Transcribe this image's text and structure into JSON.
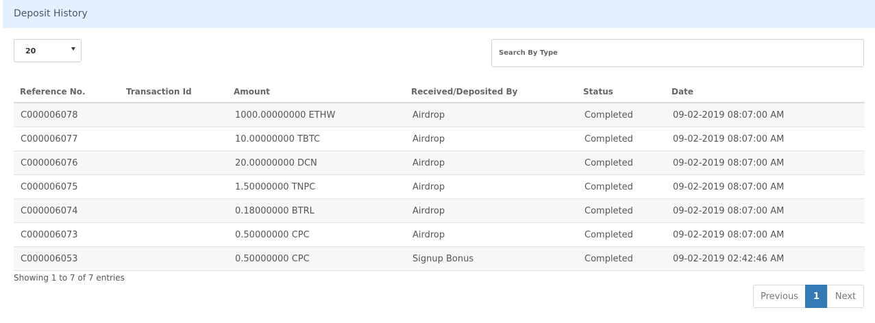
{
  "panel": {
    "title": "Deposit History"
  },
  "length": {
    "selected": "20"
  },
  "search": {
    "placeholder": "Search By Type",
    "value": ""
  },
  "table": {
    "headers": [
      "Reference No.",
      "Transaction Id",
      "Amount",
      "Received/Deposited By",
      "Status",
      "Date"
    ],
    "rows": [
      {
        "ref": "C000006078",
        "txid": "",
        "amount": "1000.00000000 ETHW",
        "by": "Airdrop",
        "status": "Completed",
        "date": "09-02-2019 08:07:00 AM"
      },
      {
        "ref": "C000006077",
        "txid": "",
        "amount": "10.00000000 TBTC",
        "by": "Airdrop",
        "status": "Completed",
        "date": "09-02-2019 08:07:00 AM"
      },
      {
        "ref": "C000006076",
        "txid": "",
        "amount": "20.00000000 DCN",
        "by": "Airdrop",
        "status": "Completed",
        "date": "09-02-2019 08:07:00 AM"
      },
      {
        "ref": "C000006075",
        "txid": "",
        "amount": "1.50000000 TNPC",
        "by": "Airdrop",
        "status": "Completed",
        "date": "09-02-2019 08:07:00 AM"
      },
      {
        "ref": "C000006074",
        "txid": "",
        "amount": "0.18000000 BTRL",
        "by": "Airdrop",
        "status": "Completed",
        "date": "09-02-2019 08:07:00 AM"
      },
      {
        "ref": "C000006073",
        "txid": "",
        "amount": "0.50000000 CPC",
        "by": "Airdrop",
        "status": "Completed",
        "date": "09-02-2019 08:07:00 AM"
      },
      {
        "ref": "C000006053",
        "txid": "",
        "amount": "0.50000000 CPC",
        "by": "Signup Bonus",
        "status": "Completed",
        "date": "09-02-2019 02:42:46 AM"
      }
    ]
  },
  "info": {
    "text": "Showing 1 to 7 of 7 entries"
  },
  "pagination": {
    "previous": "Previous",
    "current": "1",
    "next": "Next"
  },
  "colors": {
    "header_bg": "#e3f0fd",
    "active_page": "#337ab7",
    "striped_row": "#f7f7f7"
  }
}
